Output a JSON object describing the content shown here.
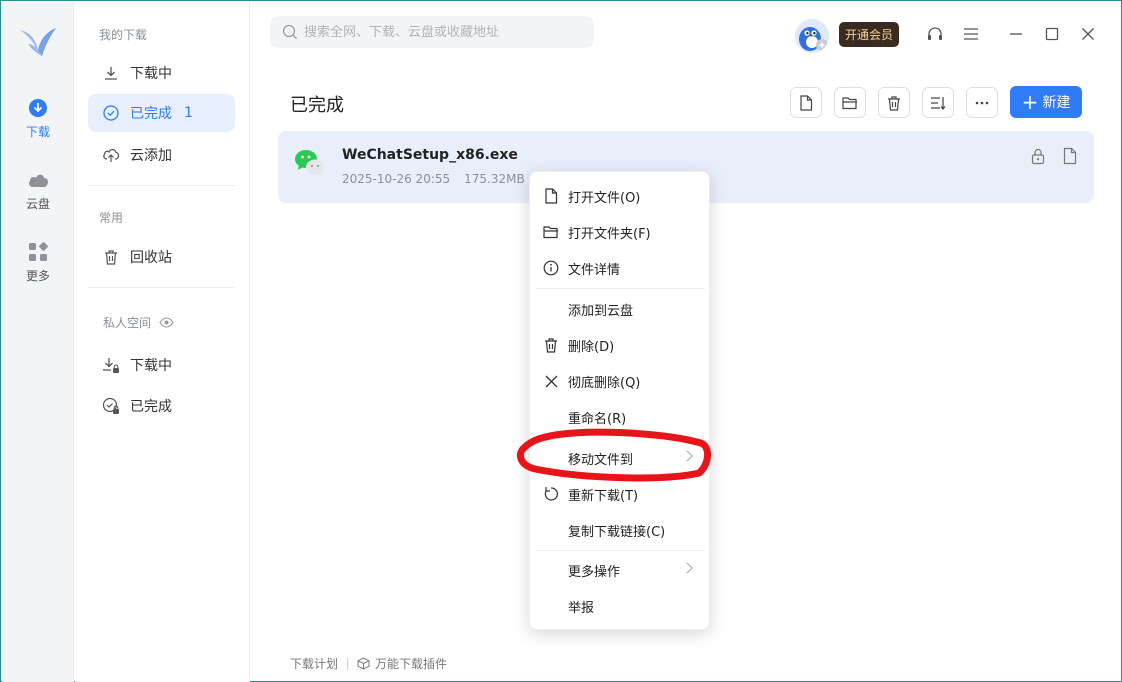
{
  "rail": {
    "items": [
      {
        "label": "下载",
        "icon": "download-circle-icon"
      },
      {
        "label": "云盘",
        "icon": "cloud-icon"
      },
      {
        "label": "更多",
        "icon": "grid-icon"
      }
    ]
  },
  "sidebar": {
    "section_my_downloads": "我的下载",
    "downloading": "下载中",
    "completed": "已完成",
    "completed_count": "1",
    "cloud_add": "云添加",
    "section_common": "常用",
    "recycle_bin": "回收站",
    "section_private": "私人空间",
    "private_downloading": "下载中",
    "private_completed": "已完成"
  },
  "search": {
    "placeholder": "搜索全网、下载、云盘或收藏地址"
  },
  "header": {
    "vip_label": "开通会员"
  },
  "main": {
    "title": "已完成",
    "new_button": "新建"
  },
  "file": {
    "name": "WeChatSetup_x86.exe",
    "date": "2025-10-26 20:55",
    "size": "175.32MB"
  },
  "context_menu": {
    "items": [
      {
        "label": "打开文件(O)",
        "icon": "file-icon"
      },
      {
        "label": "打开文件夹(F)",
        "icon": "folder-icon"
      },
      {
        "label": "文件详情",
        "icon": "info-icon"
      },
      {
        "label": "添加到云盘",
        "icon": ""
      },
      {
        "label": "删除(D)",
        "icon": "trash-icon"
      },
      {
        "label": "彻底删除(Q)",
        "icon": "close-icon"
      },
      {
        "label": "重命名(R)",
        "icon": ""
      },
      {
        "label": "移动文件到",
        "icon": ""
      },
      {
        "label": "重新下载(T)",
        "icon": "redo-icon"
      },
      {
        "label": "复制下载链接(C)",
        "icon": ""
      },
      {
        "label": "更多操作",
        "icon": ""
      },
      {
        "label": "举报",
        "icon": ""
      }
    ]
  },
  "footer": {
    "plan": "下载计划",
    "plugin": "万能下载插件"
  },
  "colors": {
    "accent": "#2f7cf6",
    "selected_bg": "#e7eefc",
    "row_bg": "#e9eefb",
    "annotation": "#e8141a"
  }
}
